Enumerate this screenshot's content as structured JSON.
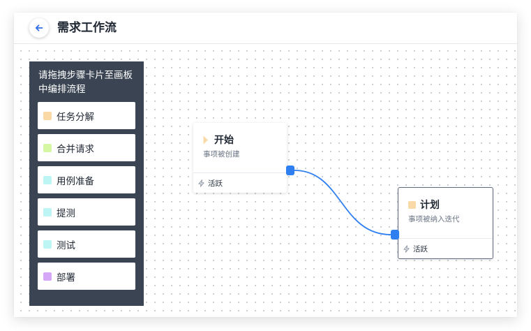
{
  "header": {
    "title": "需求工作流",
    "back_icon": "arrow-left-icon"
  },
  "palette": {
    "hint": "请拖拽步骤卡片至画板中编排流程",
    "items": [
      {
        "label": "任务分解",
        "color": "#fbd9a6"
      },
      {
        "label": "合并请求",
        "color": "#d5f7a4"
      },
      {
        "label": "用例准备",
        "color": "#bdf4f4"
      },
      {
        "label": "提测",
        "color": "#bdf4f4"
      },
      {
        "label": "测试",
        "color": "#bdf4f4"
      },
      {
        "label": "部署",
        "color": "#d4a7f7"
      }
    ]
  },
  "nodes": {
    "start": {
      "title": "开始",
      "description": "事项被创建",
      "status": "活跃",
      "marker_color": "#f9d9a8",
      "icon": "triangle-marker-icon"
    },
    "plan": {
      "title": "计划",
      "description": "事项被纳入迭代",
      "status": "活跃",
      "marker_color": "#f9d9a8",
      "icon": "square-marker-icon"
    }
  },
  "status_icon": "lightning-icon",
  "colors": {
    "accent": "#2f7ff0",
    "palette_bg": "#3b4452"
  }
}
